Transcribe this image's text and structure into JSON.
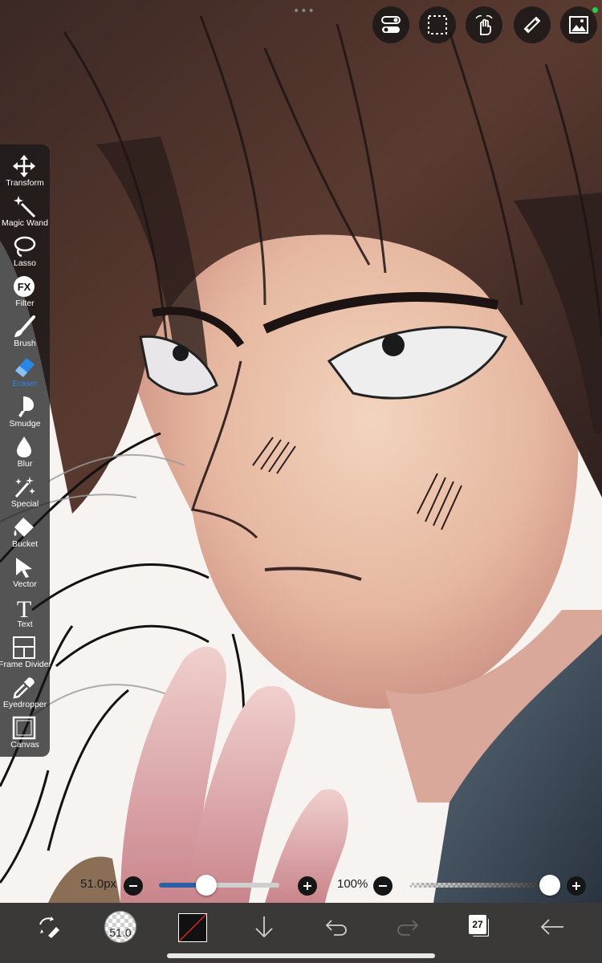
{
  "top_toolbar": {
    "more_dots": "•••",
    "buttons": [
      {
        "name": "toggle-icon"
      },
      {
        "name": "selection-icon"
      },
      {
        "name": "hand-gesture-icon"
      },
      {
        "name": "ruler-icon"
      },
      {
        "name": "gallery-icon"
      }
    ]
  },
  "tools": [
    {
      "label": "Transform",
      "icon": "transform-icon"
    },
    {
      "label": "Magic Wand",
      "icon": "magic-wand-icon"
    },
    {
      "label": "Lasso",
      "icon": "lasso-icon"
    },
    {
      "label": "Filter",
      "icon": "filter-fx-icon"
    },
    {
      "label": "Brush",
      "icon": "brush-icon"
    },
    {
      "label": "Eraser",
      "icon": "eraser-icon",
      "active": true
    },
    {
      "label": "Smudge",
      "icon": "smudge-icon"
    },
    {
      "label": "Blur",
      "icon": "blur-drop-icon"
    },
    {
      "label": "Special",
      "icon": "special-sparkle-icon"
    },
    {
      "label": "Bucket",
      "icon": "bucket-icon"
    },
    {
      "label": "Vector",
      "icon": "vector-arrow-icon"
    },
    {
      "label": "Text",
      "icon": "text-icon"
    },
    {
      "label": "Frame Divider",
      "icon": "frame-divider-icon"
    },
    {
      "label": "Eyedropper",
      "icon": "eyedropper-icon"
    },
    {
      "label": "Canvas",
      "icon": "canvas-icon"
    }
  ],
  "brush_size": {
    "label": "51.0px",
    "fraction": 0.39,
    "minus_icon": "minus-icon",
    "plus_icon": "plus-icon"
  },
  "opacity": {
    "label": "100%",
    "fraction": 1.0,
    "minus_icon": "minus-icon",
    "plus_icon": "plus-icon"
  },
  "bottom_bar": {
    "swap_icon": "swap-tool-icon",
    "brush_preview_value": "51.0",
    "color_swatch": "#111111",
    "download_icon": "arrow-down-icon",
    "undo_icon": "undo-icon",
    "redo_icon": "redo-icon",
    "layers_count": "27",
    "back_icon": "arrow-left-icon"
  },
  "colors": {
    "accent": "#2a86e6",
    "toolbar_bg": "#3a3937",
    "active_indicator": "#29d046"
  }
}
